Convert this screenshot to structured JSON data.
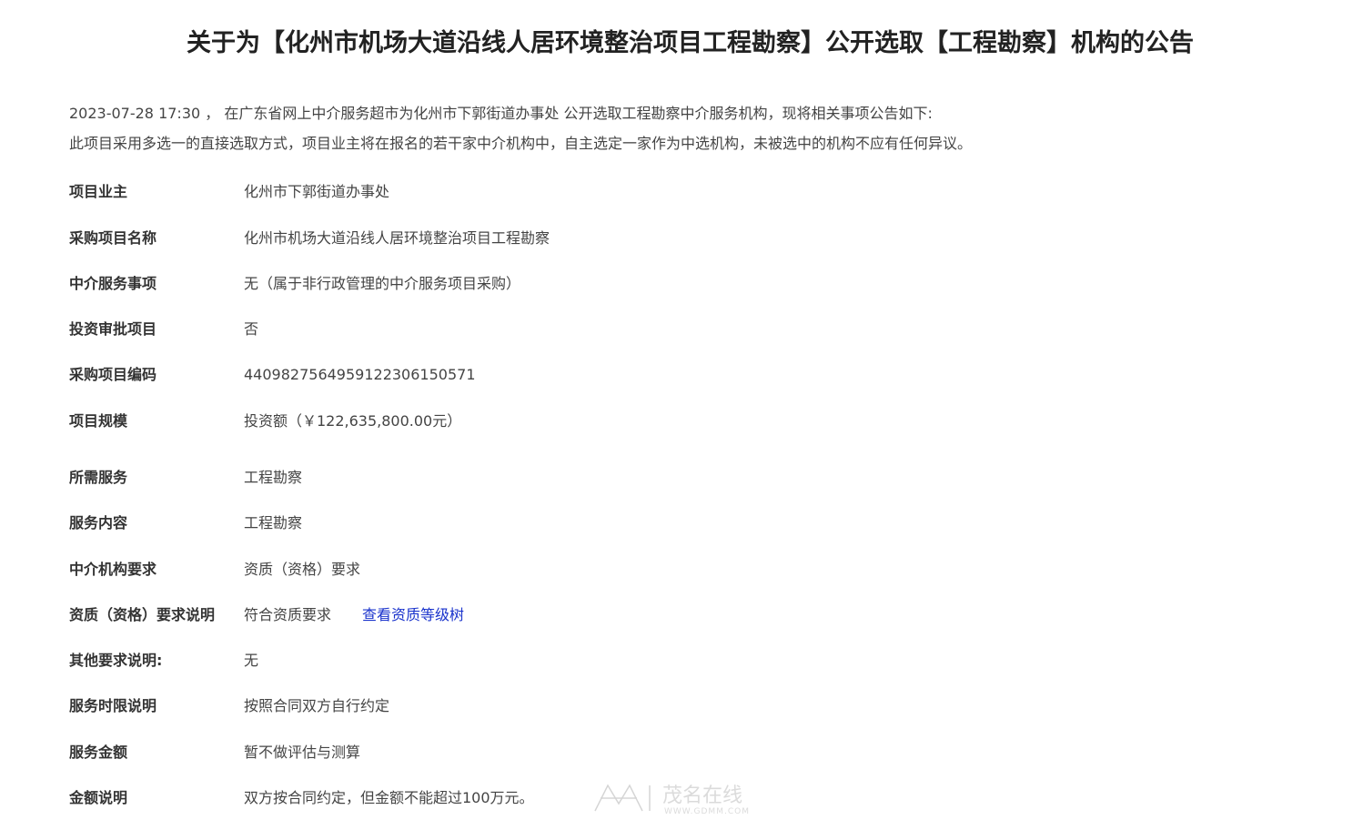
{
  "header": {
    "title": "关于为【化州市机场大道沿线人居环境整治项目工程勘察】公开选取【工程勘察】机构的公告"
  },
  "intro": {
    "line1": "2023-07-28 17:30 ， 在广东省网上中介服务超市为化州市下郭街道办事处 公开选取工程勘察中介服务机构，现将相关事项公告如下:",
    "line2": "此项目采用多选一的直接选取方式，项目业主将在报名的若干家中介机构中，自主选定一家作为中选机构，未被选中的机构不应有任何异议。"
  },
  "details": {
    "owner": {
      "label": "项目业主",
      "value": "化州市下郭街道办事处"
    },
    "project_name": {
      "label": "采购项目名称",
      "value": "化州市机场大道沿线人居环境整治项目工程勘察"
    },
    "service_item": {
      "label": "中介服务事项",
      "value": "无（属于非行政管理的中介服务项目采购）"
    },
    "investment_approval": {
      "label": "投资审批项目",
      "value": "否"
    },
    "project_code": {
      "label": "采购项目编码",
      "value": "440982756495912230615057​1"
    },
    "scale": {
      "label": "项目规模",
      "value": "投资额（￥122,635,800.00元）"
    },
    "required_service": {
      "label": "所需服务",
      "value": "工程勘察"
    },
    "service_content": {
      "label": "服务内容",
      "value": "工程勘察"
    },
    "agency_requirement": {
      "label": "中介机构要求",
      "value": "资质（资格）要求"
    },
    "qualification_desc": {
      "label": "资质（资格）要求说明",
      "value": "符合资质要求",
      "link": "查看资质等级树"
    },
    "other_requirement": {
      "label": "其他要求说明:",
      "value": "无"
    },
    "time_limit": {
      "label": "服务时限说明",
      "value": "按照合同双方自行约定"
    },
    "amount": {
      "label": "服务金额",
      "value": "暂不做评估与测算"
    },
    "amount_desc": {
      "label": "金额说明",
      "value": "双方按合同约定，但金额不能超过100万元。"
    }
  },
  "watermark": {
    "text": "茂名在线",
    "url_text": "WWW.GDMM.COM"
  }
}
